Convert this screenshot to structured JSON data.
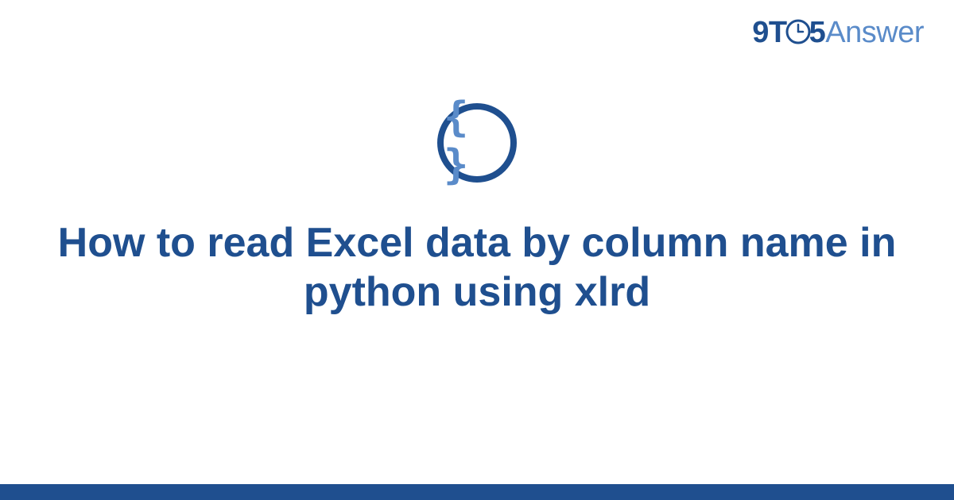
{
  "logo": {
    "prefix": "9T",
    "middle_digit": "5",
    "suffix": "Answer"
  },
  "category": {
    "icon_name": "code-braces-icon",
    "symbol": "{ }"
  },
  "title": "How to read Excel data by column name in python using xlrd",
  "colors": {
    "primary": "#1f4f8f",
    "secondary": "#5a8bc9",
    "background": "#ffffff"
  }
}
